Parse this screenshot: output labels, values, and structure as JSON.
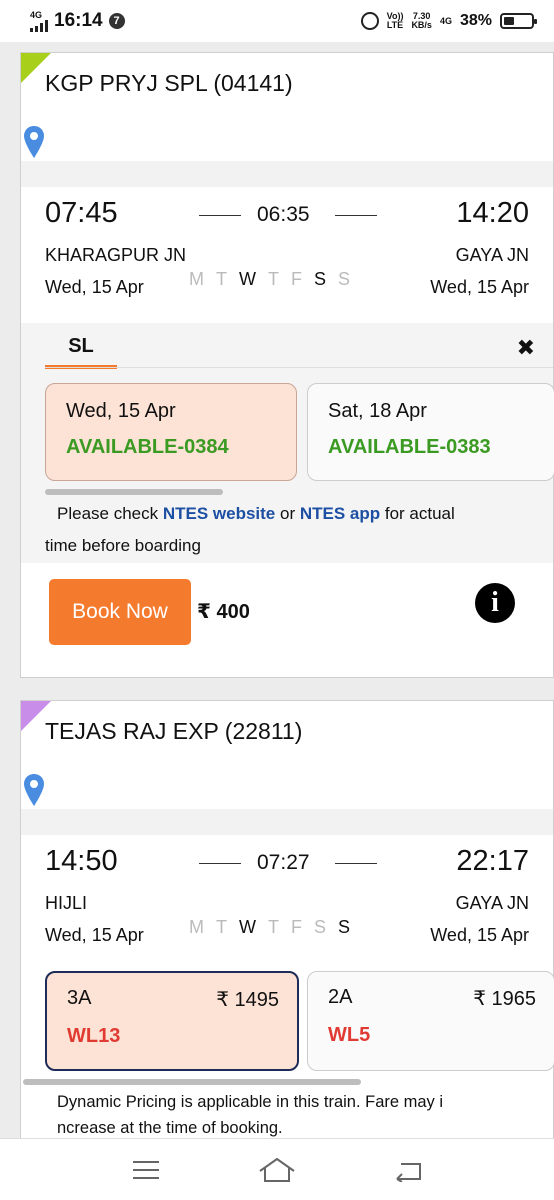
{
  "status_bar": {
    "network_top": "4G",
    "time": "16:14",
    "notification_count": "7",
    "volte_top": "Vo))",
    "volte_bottom": "LTE",
    "speed_top": "7.30",
    "speed_bottom": "KB/s",
    "network2": "4G",
    "battery_pct": "38%",
    "battery_level": 0.38
  },
  "trains": [
    {
      "name": "KGP PRYJ SPL (04141)",
      "corner_color": "#a8cf1a",
      "dep_time": "07:45",
      "arr_time": "14:20",
      "duration": "06:35",
      "from_station": "KHARAGPUR JN",
      "to_station": "GAYA JN",
      "dep_date": "Wed, 15 Apr",
      "arr_date": "Wed, 15 Apr",
      "days": [
        {
          "label": "M",
          "on": false
        },
        {
          "label": "T",
          "on": false
        },
        {
          "label": "W",
          "on": true
        },
        {
          "label": "T",
          "on": false
        },
        {
          "label": "F",
          "on": false
        },
        {
          "label": "S",
          "on": true
        },
        {
          "label": "S",
          "on": false
        }
      ],
      "class_tab": "SL",
      "close_symbol": "✖",
      "availability": [
        {
          "date": "Wed, 15 Apr",
          "status": "AVAILABLE-0384"
        },
        {
          "date": "Sat, 18 Apr",
          "status": "AVAILABLE-0383"
        }
      ],
      "note_pre": "Please check ",
      "note_link1": "NTES website",
      "note_mid": " or ",
      "note_link2": "NTES app",
      "note_post1": " for actual",
      "note_post2": "time before boarding",
      "book_label": "Book Now",
      "fare": "₹ 400"
    },
    {
      "name": "TEJAS RAJ EXP (22811)",
      "corner_color": "#c78de8",
      "dep_time": "14:50",
      "arr_time": "22:17",
      "duration": "07:27",
      "from_station": "HIJLI",
      "to_station": "GAYA JN",
      "dep_date": "Wed, 15 Apr",
      "arr_date": "Wed, 15 Apr",
      "days": [
        {
          "label": "M",
          "on": false
        },
        {
          "label": "T",
          "on": false
        },
        {
          "label": "W",
          "on": true
        },
        {
          "label": "T",
          "on": false
        },
        {
          "label": "F",
          "on": false
        },
        {
          "label": "S",
          "on": false
        },
        {
          "label": "S",
          "on": true
        }
      ],
      "classes": [
        {
          "name": "3A",
          "fare": "₹ 1495",
          "status": "WL13"
        },
        {
          "name": "2A",
          "fare": "₹ 1965",
          "status": "WL5"
        }
      ],
      "note_line1": "Dynamic Pricing is applicable in this train. Fare may i",
      "note_line2": "ncrease at the time of booking."
    }
  ],
  "colors": {
    "accent_orange": "#f47a2e",
    "available_green": "#3a9a22",
    "waitlist_red": "#e03b33",
    "link_blue": "#1d4fa3"
  }
}
